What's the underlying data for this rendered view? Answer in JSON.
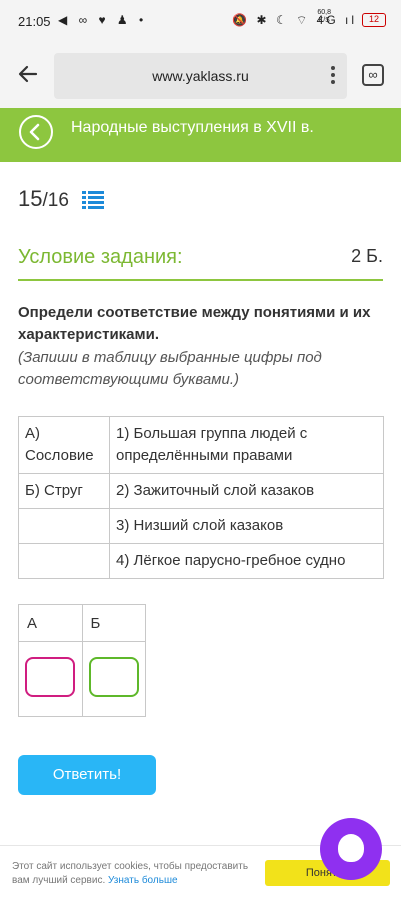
{
  "status": {
    "time": "21:05",
    "left_icons": "◀ ∞ ♥ ♟ •",
    "speed_top": "60,8",
    "speed_bottom": "K/S",
    "right_icons": "🔕 ✱ ☾ ⌔ 4G ıl",
    "battery": "12"
  },
  "browser": {
    "url": "www.yaklass.ru",
    "tabs_label": "∞"
  },
  "header": {
    "title": "Народные выступления в XVII в."
  },
  "progress": {
    "current": "15",
    "total": "/16"
  },
  "task": {
    "title": "Условие задания:",
    "points": "2 Б.",
    "instruction": "Определи соответствие между понятиями и их характеристиками.",
    "hint": "(Запиши в таблицу выбранные цифры под соответствующими буквами.)"
  },
  "match_table": {
    "rows": [
      {
        "left": "А) Сословие",
        "right": "1) Большая группа людей с определёнными правами"
      },
      {
        "left": "Б) Струг",
        "right": "2) Зажиточный слой казаков"
      },
      {
        "left": "",
        "right": "3) Низший слой казаков"
      },
      {
        "left": "",
        "right": "4) Лёгкое парусно-гребное судно"
      }
    ]
  },
  "answer_table": {
    "col_a": "А",
    "col_b": "Б",
    "value_a": "",
    "value_b": ""
  },
  "submit_label": "Ответить!",
  "cookie": {
    "text": "Этот сайт использует cookies, чтобы предоставить вам лучший сервис.",
    "link": "Узнать больше",
    "button": "Понятно"
  },
  "colors": {
    "accent_green": "#8dc63f",
    "button_blue": "#29b6f6",
    "input_a_border": "#d01d80",
    "input_b_border": "#5eb82a",
    "assistant_purple": "#8f30f0"
  }
}
